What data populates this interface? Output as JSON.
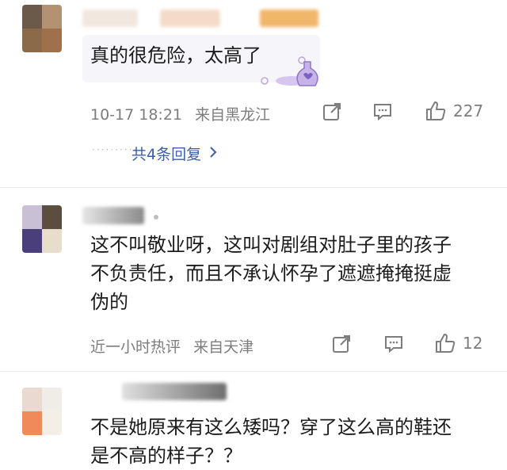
{
  "comments": [
    {
      "text_lines": [
        "真的很危险，太高了"
      ],
      "time": "10-17 18:21",
      "location": "来自黑龙江",
      "likes": "227",
      "replies_label": "共4条回复",
      "replies_icon": "chevron-right-icon",
      "sticker_icon": "potion-sticker-icon"
    },
    {
      "text_lines": [
        "这不叫敬业呀，这叫对剧组对肚子里的孩子",
        "不负责任，而且不承认怀孕了遮遮掩掩挺虚",
        "伪的"
      ],
      "time": "近一小时热评",
      "location": "来自天津",
      "likes": "12"
    },
    {
      "text_lines": [
        "不是她原来有这么矮吗？穿了这么高的鞋还",
        "是不高的样子？？"
      ]
    }
  ],
  "icons": {
    "share": "share-icon",
    "comment": "comment-icon",
    "like": "thumbs-up-icon"
  },
  "colors": {
    "meta": "#7d7d7d",
    "link": "#3b5fa8",
    "bubble": "#f6f5f9"
  }
}
